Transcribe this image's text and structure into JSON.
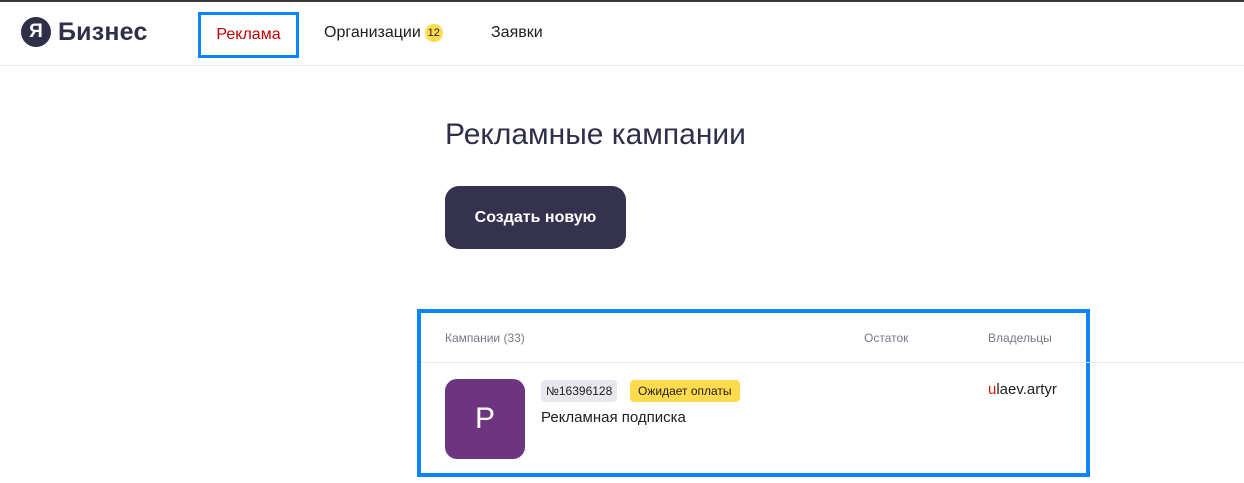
{
  "header": {
    "logo_mark": "Я",
    "logo_text": "Бизнес",
    "nav": {
      "ads": "Реклама",
      "orgs": "Организации",
      "orgs_count": "12",
      "requests": "Заявки"
    }
  },
  "main": {
    "title": "Рекламные кампании",
    "create_button": "Создать новую",
    "table": {
      "columns": {
        "campaigns": "Кампании (33)",
        "balance": "Остаток",
        "owners": "Владельцы"
      },
      "rows": [
        {
          "avatar_letter": "Р",
          "number": "№16396128",
          "status": "Ожидает оплаты",
          "name": "Рекламная подписка",
          "owner_first_letter": "u",
          "owner_rest": "laev.artyr"
        }
      ]
    }
  },
  "colors": {
    "accent_outline": "#0a84ff",
    "active_nav": "#c00000",
    "button_bg": "#34324f",
    "status_badge": "#ffdb4d",
    "avatar_bg": "#6d3480"
  }
}
